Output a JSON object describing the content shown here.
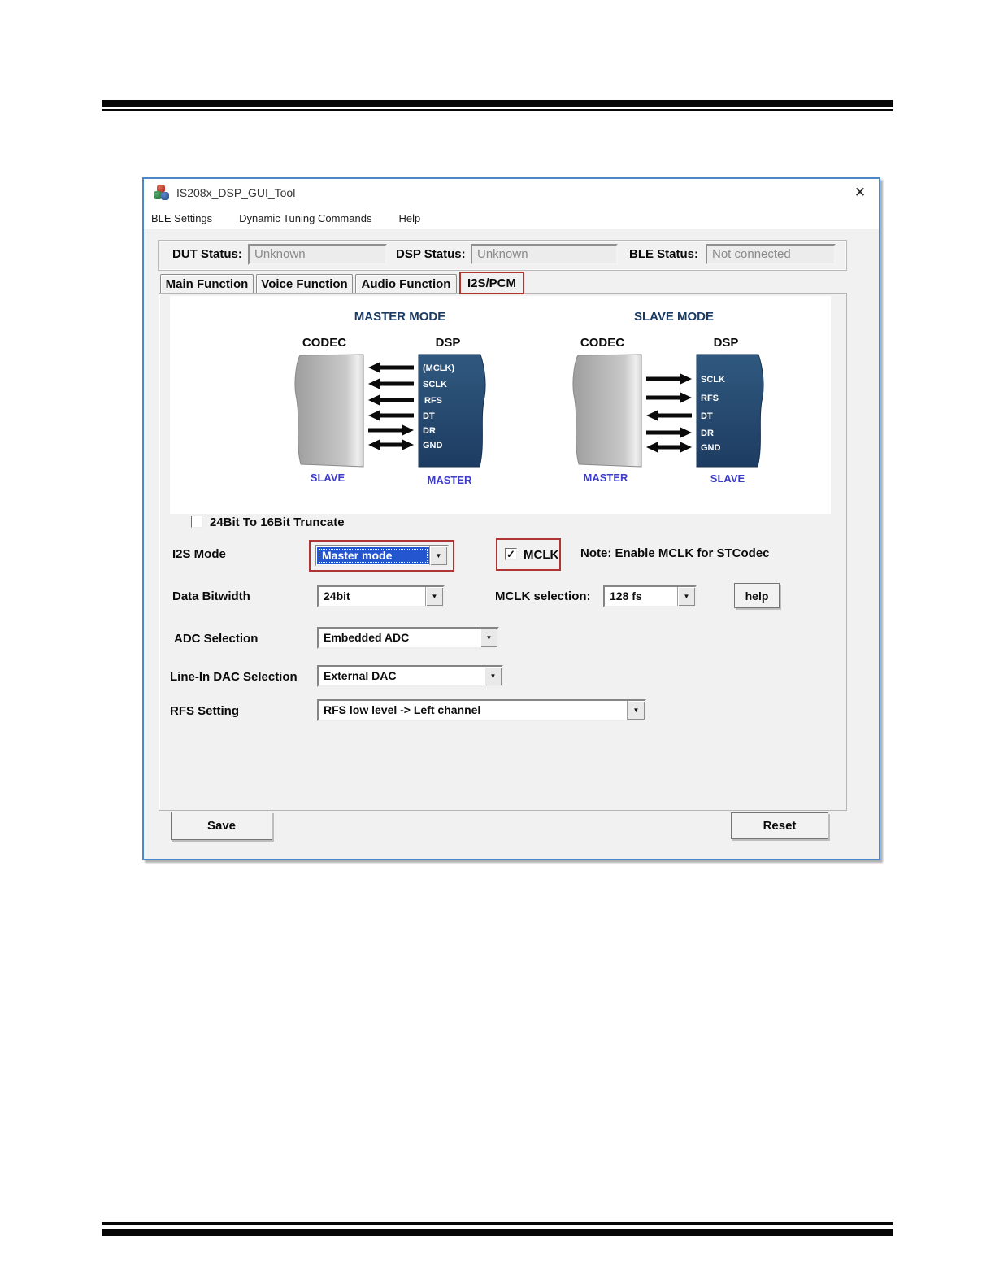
{
  "window": {
    "title": "IS208x_DSP_GUI_Tool",
    "icons": {
      "close": "✕",
      "dropdown": "▼"
    },
    "menu": [
      {
        "label": "BLE Settings"
      },
      {
        "label": "Dynamic Tuning Commands"
      },
      {
        "label": "Help"
      }
    ],
    "status": [
      {
        "label": "DUT Status:",
        "value": "Unknown"
      },
      {
        "label": "DSP Status:",
        "value": "Unknown"
      },
      {
        "label": "BLE Status:",
        "value": "Not connected"
      }
    ],
    "tabs": [
      {
        "label": "Main Function",
        "selected": false
      },
      {
        "label": "Voice Function",
        "selected": false
      },
      {
        "label": "Audio Function",
        "selected": false
      },
      {
        "label": "I2S/PCM",
        "selected": true,
        "annotated": true
      }
    ],
    "diagram": {
      "master": {
        "title": "MASTER MODE",
        "left_label": "CODEC",
        "left_role": "SLAVE",
        "right_label": "DSP",
        "right_role": "MASTER",
        "signals": [
          {
            "name": "(MCLK)",
            "direction": "left"
          },
          {
            "name": "SCLK",
            "direction": "left"
          },
          {
            "name": "RFS",
            "direction": "left"
          },
          {
            "name": "DT",
            "direction": "left"
          },
          {
            "name": "DR",
            "direction": "right"
          },
          {
            "name": "GND",
            "direction": "both"
          }
        ]
      },
      "slave": {
        "title": "SLAVE MODE",
        "left_label": "CODEC",
        "left_role": "MASTER",
        "right_label": "DSP",
        "right_role": "SLAVE",
        "signals": [
          {
            "name": "SCLK",
            "direction": "right"
          },
          {
            "name": "RFS",
            "direction": "right"
          },
          {
            "name": "DT",
            "direction": "left"
          },
          {
            "name": "DR",
            "direction": "right"
          },
          {
            "name": "GND",
            "direction": "both"
          }
        ]
      }
    },
    "form": {
      "truncate_checkbox": {
        "label": "24Bit To 16Bit Truncate",
        "checked": false,
        "glyph": ""
      },
      "i2s_mode": {
        "label": "I2S Mode",
        "value": "Master mode"
      },
      "mclk_checkbox": {
        "label": "MCLK",
        "checked": true,
        "glyph": "✓"
      },
      "mclk_note": "Note: Enable MCLK for STCodec",
      "data_bitwidth": {
        "label": "Data Bitwidth",
        "value": "24bit"
      },
      "mclk_selection": {
        "label": "MCLK selection:",
        "value": "128 fs"
      },
      "help_button": "help",
      "adc_selection": {
        "label": "ADC Selection",
        "value": "Embedded ADC"
      },
      "line_in_dac": {
        "label": "Line-In DAC Selection",
        "value": "External DAC"
      },
      "rfs_setting": {
        "label": "RFS Setting",
        "value": "RFS low level -> Left channel"
      },
      "save_button": "Save",
      "reset_button": "Reset"
    },
    "colors": {
      "annotation_red": "#b03434",
      "window_border_blue": "#4c88c7",
      "selection_blue": "#2456cf",
      "diagram_navy": "#24466d",
      "diagram_role_blue": "#3d3dcc",
      "heading_navy": "#1b3a63"
    }
  }
}
